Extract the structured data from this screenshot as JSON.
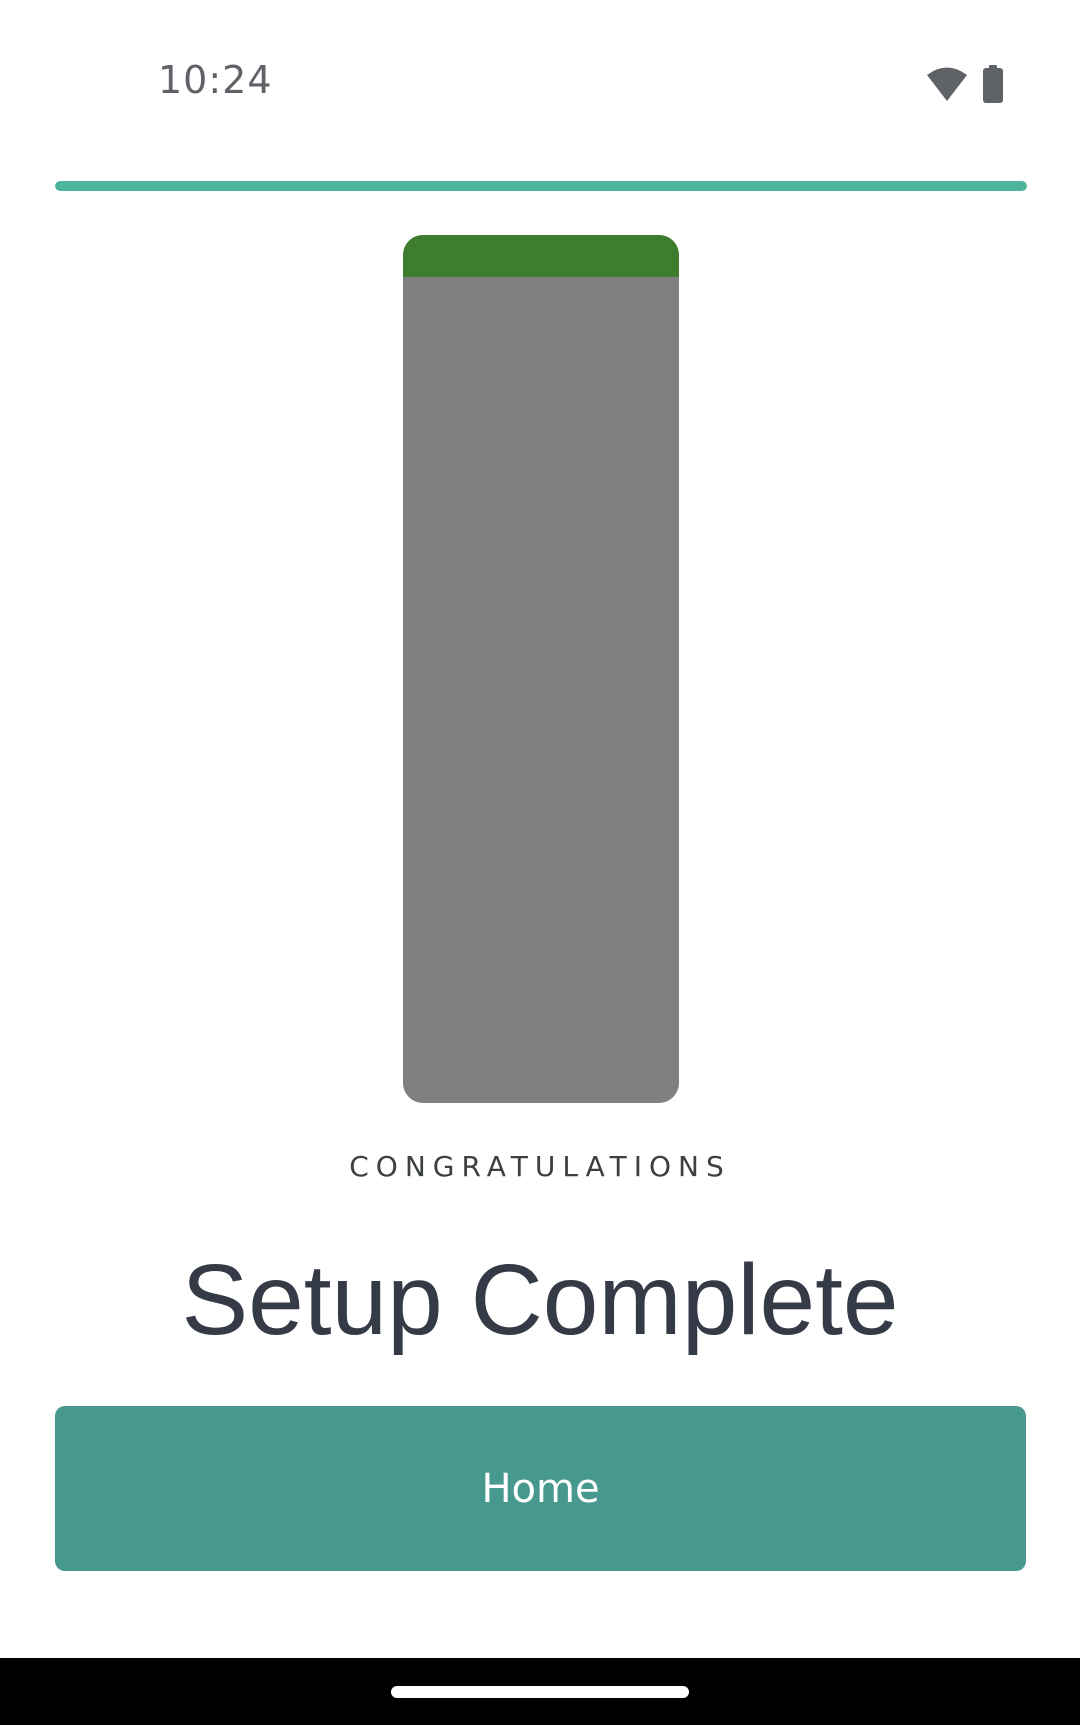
{
  "status_bar": {
    "time": "10:24",
    "icons": [
      "wifi-icon",
      "battery-icon"
    ]
  },
  "progress": {
    "fraction": 1.0,
    "color": "#4cb59c"
  },
  "illustration": {
    "body_color": "#808080",
    "top_color": "#3e7d2d"
  },
  "content": {
    "label": "CONGRATULATIONS",
    "title": "Setup Complete"
  },
  "actions": {
    "home_label": "Home",
    "button_color": "#47998f"
  },
  "nav_bar": {
    "handle": "gesture-handle"
  }
}
